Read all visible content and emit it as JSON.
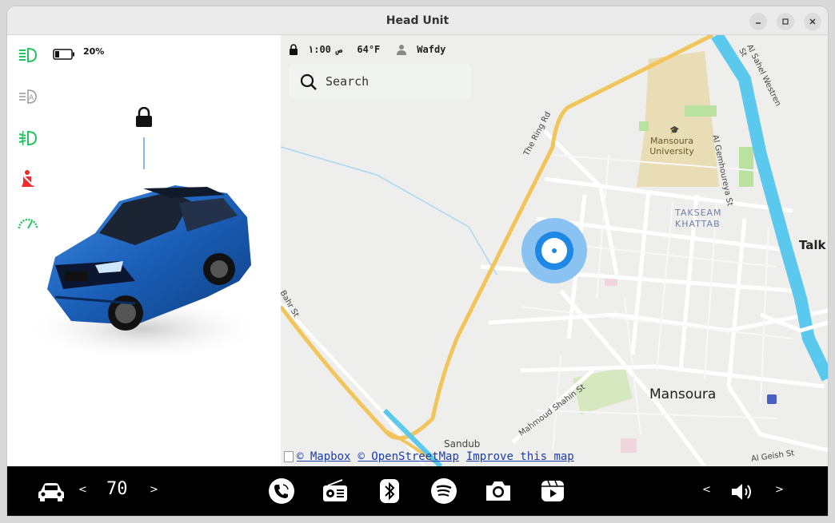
{
  "window": {
    "title": "Head Unit"
  },
  "dashboard": {
    "battery_percent": "20%",
    "battery_level": 0.2
  },
  "map": {
    "status": {
      "time": "١:00 ص",
      "temperature": "64°F",
      "user": "Wafdy"
    },
    "search_placeholder": "Search",
    "labels": {
      "ring_road": "The Ring Rd",
      "university": "Mansoura University",
      "takseam_1": "TAKSEAM",
      "takseam_2": "KHATTAB",
      "gemhoureya": "Al Gemhoureya St",
      "sahel": "Al Sahel Westren St",
      "talk": "Talk",
      "bahr": "Bahr St",
      "mansoura": "Mansoura",
      "mahmoud": "Mahmoud Shahin St",
      "sandub": "Sandub",
      "geish": "Al Geish St"
    },
    "attribution": {
      "mapbox": "© Mapbox",
      "osm": "© OpenStreetMap",
      "improve": "Improve this map"
    }
  },
  "bottom": {
    "speed": "70",
    "left_prev": "<",
    "left_next": ">",
    "vol_down": "<",
    "vol_up": ">"
  },
  "colors": {
    "indicator_green": "#22c55e",
    "warning_red": "#ef2c2c",
    "location_blue": "#1e88e5",
    "river": "#5bc8ee",
    "road_yellow": "#f2c55c"
  }
}
